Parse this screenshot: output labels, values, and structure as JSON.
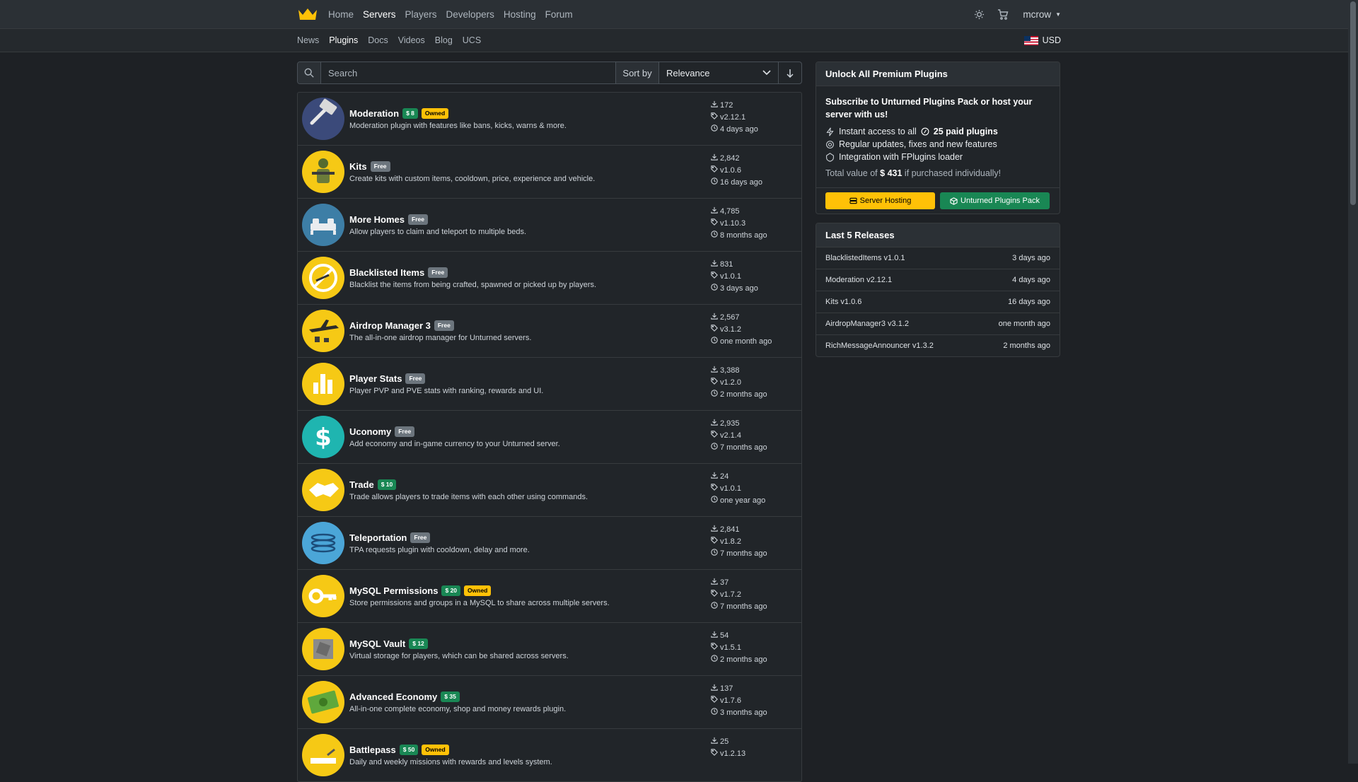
{
  "topnav": {
    "links": [
      "Home",
      "Servers",
      "Players",
      "Developers",
      "Hosting",
      "Forum"
    ],
    "active": "Servers",
    "user": "mcrow"
  },
  "subnav": {
    "links": [
      "News",
      "Plugins",
      "Docs",
      "Videos",
      "Blog",
      "UCS"
    ],
    "active": "Plugins",
    "currency": "USD"
  },
  "search": {
    "placeholder": "Search",
    "sort_label": "Sort by",
    "sort_value": "Relevance"
  },
  "plugins": [
    {
      "name": "Moderation",
      "price": "$ 8",
      "owned": "Owned",
      "desc": "Moderation plugin with features like bans, kicks, warns & more.",
      "downloads": "172",
      "version": "v2.12.1",
      "updated": "4 days ago",
      "color": "#3b4a7a",
      "icon": "hammer-icon"
    },
    {
      "name": "Kits",
      "free": "Free",
      "desc": "Create kits with custom items, cooldown, price, experience and vehicle.",
      "downloads": "2,842",
      "version": "v1.0.6",
      "updated": "16 days ago",
      "color": "#f6c915",
      "icon": "soldier-icon"
    },
    {
      "name": "More Homes",
      "free": "Free",
      "desc": "Allow players to claim and teleport to multiple beds.",
      "downloads": "4,785",
      "version": "v1.10.3",
      "updated": "8 months ago",
      "color": "#3d7ea6",
      "icon": "bed-icon"
    },
    {
      "name": "Blacklisted Items",
      "free": "Free",
      "desc": "Blacklist the items from being crafted, spawned or picked up by players.",
      "downloads": "831",
      "version": "v1.0.1",
      "updated": "3 days ago",
      "color": "#f6c915",
      "icon": "blocked-icon"
    },
    {
      "name": "Airdrop Manager 3",
      "free": "Free",
      "desc": "The all-in-one airdrop manager for Unturned servers.",
      "downloads": "2,567",
      "version": "v3.1.2",
      "updated": "one month ago",
      "color": "#f6c915",
      "icon": "airplane-icon"
    },
    {
      "name": "Player Stats",
      "free": "Free",
      "desc": "Player PVP and PVE stats with ranking, rewards and UI.",
      "downloads": "3,388",
      "version": "v1.2.0",
      "updated": "2 months ago",
      "color": "#f6c915",
      "icon": "bar-chart-icon"
    },
    {
      "name": "Uconomy",
      "free": "Free",
      "desc": "Add economy and in-game currency to your Unturned server.",
      "downloads": "2,935",
      "version": "v2.1.4",
      "updated": "7 months ago",
      "color": "#1fb5b0",
      "icon": "dollar-icon"
    },
    {
      "name": "Trade",
      "price": "$ 10",
      "desc": "Trade allows players to trade items with each other using commands.",
      "downloads": "24",
      "version": "v1.0.1",
      "updated": "one year ago",
      "color": "#f6c915",
      "icon": "handshake-icon"
    },
    {
      "name": "Teleportation",
      "free": "Free",
      "desc": "TPA requests plugin with cooldown, delay and more.",
      "downloads": "2,841",
      "version": "v1.8.2",
      "updated": "7 months ago",
      "color": "#4ba6d8",
      "icon": "portal-icon"
    },
    {
      "name": "MySQL Permissions",
      "price": "$ 20",
      "owned": "Owned",
      "desc": "Store permissions and groups in a MySQL to share across multiple servers.",
      "downloads": "37",
      "version": "v1.7.2",
      "updated": "7 months ago",
      "color": "#f6c915",
      "icon": "key-icon"
    },
    {
      "name": "MySQL Vault",
      "price": "$ 12",
      "desc": "Virtual storage for players, which can be shared across servers.",
      "downloads": "54",
      "version": "v1.5.1",
      "updated": "2 months ago",
      "color": "#f6c915",
      "icon": "vault-icon"
    },
    {
      "name": "Advanced Economy",
      "price": "$ 35",
      "desc": "All-in-one complete economy, shop and money rewards plugin.",
      "downloads": "137",
      "version": "v1.7.6",
      "updated": "3 months ago",
      "color": "#f6c915",
      "icon": "money-icon"
    },
    {
      "name": "Battlepass",
      "price": "$ 50",
      "owned": "Owned",
      "desc": "Daily and weekly missions with rewards and levels system.",
      "downloads": "25",
      "version": "v1.2.13",
      "updated": "",
      "color": "#f6c915",
      "icon": "pass-icon"
    }
  ],
  "premium": {
    "title": "Unlock All Premium Plugins",
    "subscribe": "Subscribe to Unturned Plugins Pack or host your server with us!",
    "features": [
      {
        "text": "Instant access to all",
        "bold": "25 paid plugins",
        "icon": "bolt-icon"
      },
      {
        "text": "Regular updates, fixes and new features",
        "bold": "",
        "icon": "gear-icon"
      },
      {
        "text": "Integration with FPlugins loader",
        "bold": "",
        "icon": "shield-icon"
      }
    ],
    "total_prefix": "Total value of",
    "total_value": "$ 431",
    "total_suffix": "if purchased individually!",
    "btn_hosting": "Server Hosting",
    "btn_pack": "Unturned Plugins Pack"
  },
  "releases": {
    "title": "Last 5 Releases",
    "items": [
      {
        "name": "BlacklistedItems v1.0.1",
        "when": "3 days ago"
      },
      {
        "name": "Moderation v2.12.1",
        "when": "4 days ago"
      },
      {
        "name": "Kits v1.0.6",
        "when": "16 days ago"
      },
      {
        "name": "AirdropManager3 v3.1.2",
        "when": "one month ago"
      },
      {
        "name": "RichMessageAnnouncer v1.3.2",
        "when": "2 months ago"
      }
    ]
  },
  "colors": {
    "accent": "#ffc107",
    "success": "#198754"
  }
}
